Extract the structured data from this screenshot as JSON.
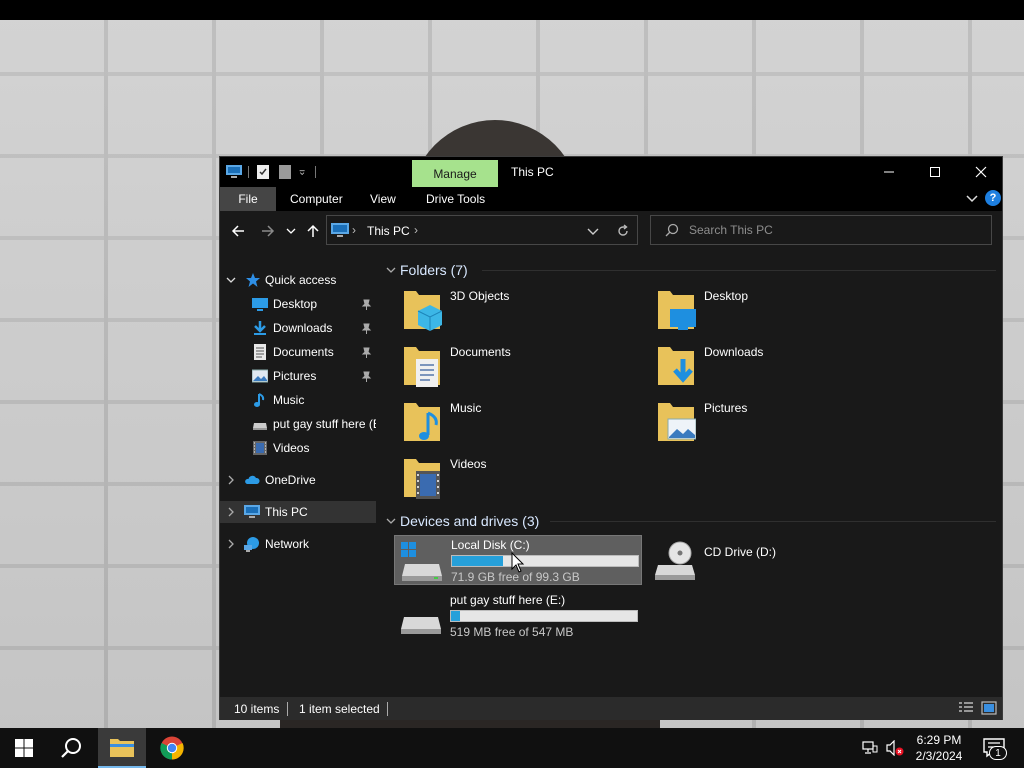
{
  "window": {
    "title": "This PC",
    "context_tab": "Manage",
    "ribbon_tabs": [
      "File",
      "Computer",
      "View",
      "Drive Tools"
    ]
  },
  "address": {
    "path": "This PC",
    "sep": "›"
  },
  "search": {
    "placeholder": "Search This PC"
  },
  "help_label": "?",
  "nav_pane": {
    "quick_access": {
      "label": "Quick access",
      "items": [
        {
          "label": "Desktop",
          "icon": "desktop-icon",
          "pinned": true
        },
        {
          "label": "Downloads",
          "icon": "downloads-icon",
          "pinned": true
        },
        {
          "label": "Documents",
          "icon": "documents-icon",
          "pinned": true
        },
        {
          "label": "Pictures",
          "icon": "pictures-icon",
          "pinned": true
        },
        {
          "label": "Music",
          "icon": "music-icon",
          "pinned": false
        },
        {
          "label": "put gay stuff here (E",
          "icon": "drive-icon",
          "pinned": false
        },
        {
          "label": "Videos",
          "icon": "videos-icon",
          "pinned": false
        }
      ]
    },
    "onedrive": "OneDrive",
    "this_pc": "This PC",
    "network": "Network"
  },
  "content": {
    "folders_header": "Folders (7)",
    "folders": [
      {
        "label": "3D Objects",
        "icon": "3d-objects-icon"
      },
      {
        "label": "Desktop",
        "icon": "desktop-icon"
      },
      {
        "label": "Documents",
        "icon": "documents-icon"
      },
      {
        "label": "Downloads",
        "icon": "downloads-icon"
      },
      {
        "label": "Music",
        "icon": "music-icon"
      },
      {
        "label": "Pictures",
        "icon": "pictures-icon"
      },
      {
        "label": "Videos",
        "icon": "videos-icon"
      }
    ],
    "devices_header": "Devices and drives (3)",
    "drives": [
      {
        "label": "Local Disk (C:)",
        "free_text": "71.9 GB free of 99.3 GB",
        "used_fraction": 0.276,
        "selected": true
      },
      {
        "label": "CD Drive (D:)"
      },
      {
        "label": "put gay stuff here (E:)",
        "free_text": "519 MB free of 547 MB",
        "used_fraction": 0.051,
        "selected": false
      }
    ]
  },
  "status": {
    "items": "10 items",
    "selected": "1 item selected"
  },
  "taskbar": {
    "time": "6:29 PM",
    "date": "2/3/2024",
    "notification_count": "1"
  },
  "colors": {
    "accent": "#26a0da",
    "manage_tab": "#a6e28d",
    "window_bg": "#191919",
    "folder": "#e8c25a"
  }
}
